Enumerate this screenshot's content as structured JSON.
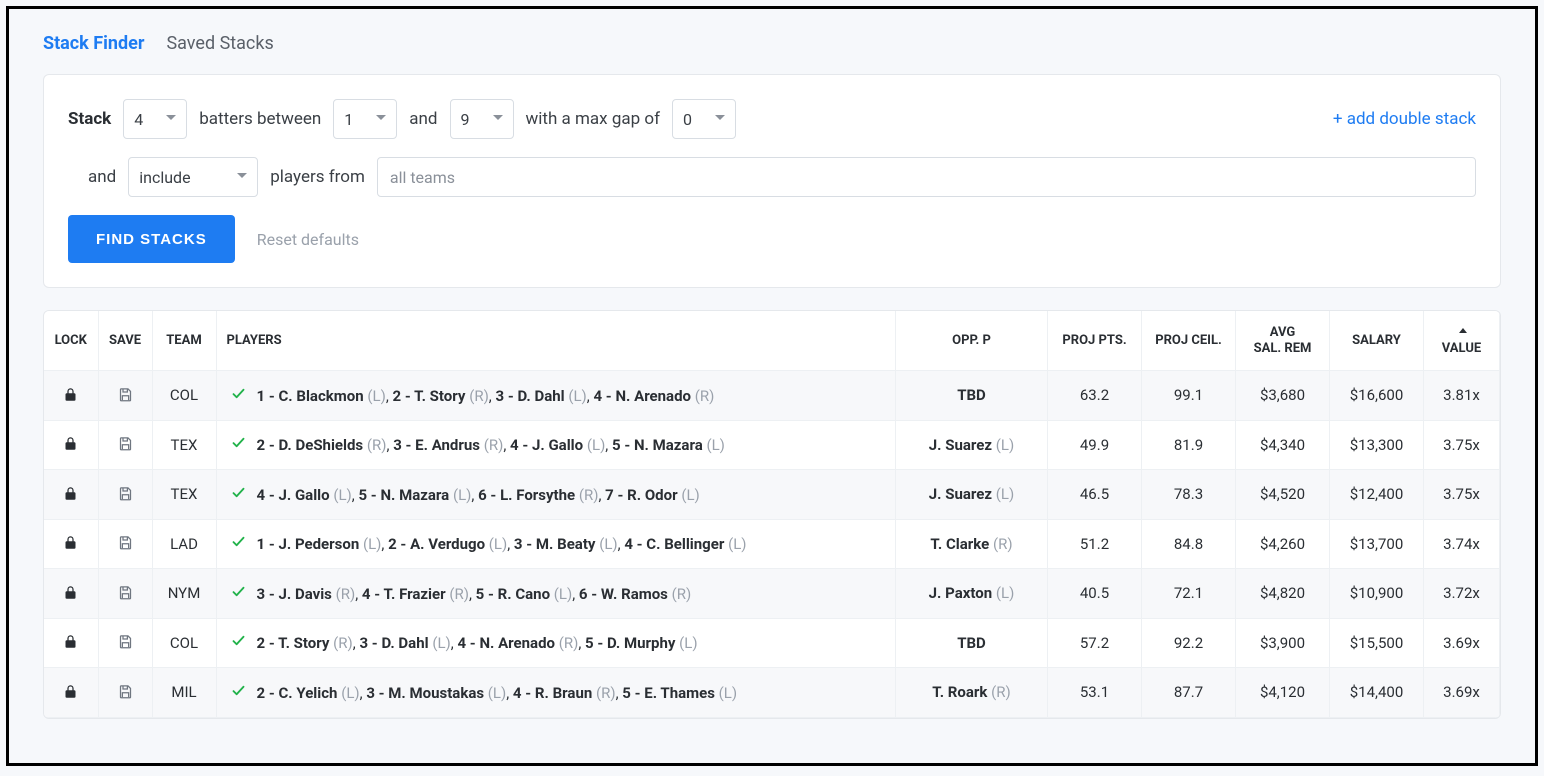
{
  "tabs": {
    "active": "Stack Finder",
    "other": "Saved Stacks"
  },
  "filters": {
    "label_stack": "Stack",
    "batters_count": "4",
    "label_batters_between": "batters between",
    "between_from": "1",
    "label_and": "and",
    "between_to": "9",
    "label_max_gap": "with a max gap of",
    "max_gap": "0",
    "row2_label_and": "and",
    "include_select": "include",
    "label_players_from": "players from",
    "teams_placeholder": "all teams",
    "add_double_stack": "+ add double stack"
  },
  "actions": {
    "find_stacks": "FIND STACKS",
    "reset": "Reset defaults"
  },
  "columns": {
    "lock": "LOCK",
    "save": "SAVE",
    "team": "TEAM",
    "players": "PLAYERS",
    "opp": "OPP. P",
    "proj_pts": "PROJ PTS.",
    "proj_ceil": "PROJ CEIL.",
    "avg_sal_rem1": "AVG",
    "avg_sal_rem2": "SAL. REM",
    "salary": "SALARY",
    "value": "VALUE"
  },
  "rows": [
    {
      "team": "COL",
      "players": [
        {
          "num": "1",
          "name": "C. Blackmon",
          "hand": "(L)"
        },
        {
          "num": "2",
          "name": "T. Story",
          "hand": "(R)"
        },
        {
          "num": "3",
          "name": "D. Dahl",
          "hand": "(L)"
        },
        {
          "num": "4",
          "name": "N. Arenado",
          "hand": "(R)"
        }
      ],
      "opp_name": "TBD",
      "opp_hand": "",
      "proj_pts": "63.2",
      "proj_ceil": "99.1",
      "avg_sal": "$3,680",
      "salary": "$16,600",
      "value": "3.81x"
    },
    {
      "team": "TEX",
      "players": [
        {
          "num": "2",
          "name": "D. DeShields",
          "hand": "(R)"
        },
        {
          "num": "3",
          "name": "E. Andrus",
          "hand": "(R)"
        },
        {
          "num": "4",
          "name": "J. Gallo",
          "hand": "(L)"
        },
        {
          "num": "5",
          "name": "N. Mazara",
          "hand": "(L)"
        }
      ],
      "opp_name": "J. Suarez",
      "opp_hand": "(L)",
      "proj_pts": "49.9",
      "proj_ceil": "81.9",
      "avg_sal": "$4,340",
      "salary": "$13,300",
      "value": "3.75x"
    },
    {
      "team": "TEX",
      "players": [
        {
          "num": "4",
          "name": "J. Gallo",
          "hand": "(L)"
        },
        {
          "num": "5",
          "name": "N. Mazara",
          "hand": "(L)"
        },
        {
          "num": "6",
          "name": "L. Forsythe",
          "hand": "(R)"
        },
        {
          "num": "7",
          "name": "R. Odor",
          "hand": "(L)"
        }
      ],
      "opp_name": "J. Suarez",
      "opp_hand": "(L)",
      "proj_pts": "46.5",
      "proj_ceil": "78.3",
      "avg_sal": "$4,520",
      "salary": "$12,400",
      "value": "3.75x"
    },
    {
      "team": "LAD",
      "players": [
        {
          "num": "1",
          "name": "J. Pederson",
          "hand": "(L)"
        },
        {
          "num": "2",
          "name": "A. Verdugo",
          "hand": "(L)"
        },
        {
          "num": "3",
          "name": "M. Beaty",
          "hand": "(L)"
        },
        {
          "num": "4",
          "name": "C. Bellinger",
          "hand": "(L)"
        }
      ],
      "opp_name": "T. Clarke",
      "opp_hand": "(R)",
      "proj_pts": "51.2",
      "proj_ceil": "84.8",
      "avg_sal": "$4,260",
      "salary": "$13,700",
      "value": "3.74x"
    },
    {
      "team": "NYM",
      "players": [
        {
          "num": "3",
          "name": "J. Davis",
          "hand": "(R)"
        },
        {
          "num": "4",
          "name": "T. Frazier",
          "hand": "(R)"
        },
        {
          "num": "5",
          "name": "R. Cano",
          "hand": "(L)"
        },
        {
          "num": "6",
          "name": "W. Ramos",
          "hand": "(R)"
        }
      ],
      "opp_name": "J. Paxton",
      "opp_hand": "(L)",
      "proj_pts": "40.5",
      "proj_ceil": "72.1",
      "avg_sal": "$4,820",
      "salary": "$10,900",
      "value": "3.72x"
    },
    {
      "team": "COL",
      "players": [
        {
          "num": "2",
          "name": "T. Story",
          "hand": "(R)"
        },
        {
          "num": "3",
          "name": "D. Dahl",
          "hand": "(L)"
        },
        {
          "num": "4",
          "name": "N. Arenado",
          "hand": "(R)"
        },
        {
          "num": "5",
          "name": "D. Murphy",
          "hand": "(L)"
        }
      ],
      "opp_name": "TBD",
      "opp_hand": "",
      "proj_pts": "57.2",
      "proj_ceil": "92.2",
      "avg_sal": "$3,900",
      "salary": "$15,500",
      "value": "3.69x"
    },
    {
      "team": "MIL",
      "players": [
        {
          "num": "2",
          "name": "C. Yelich",
          "hand": "(L)"
        },
        {
          "num": "3",
          "name": "M. Moustakas",
          "hand": "(L)"
        },
        {
          "num": "4",
          "name": "R. Braun",
          "hand": "(R)"
        },
        {
          "num": "5",
          "name": "E. Thames",
          "hand": "(L)"
        }
      ],
      "opp_name": "T. Roark",
      "opp_hand": "(R)",
      "proj_pts": "53.1",
      "proj_ceil": "87.7",
      "avg_sal": "$4,120",
      "salary": "$14,400",
      "value": "3.69x"
    }
  ]
}
